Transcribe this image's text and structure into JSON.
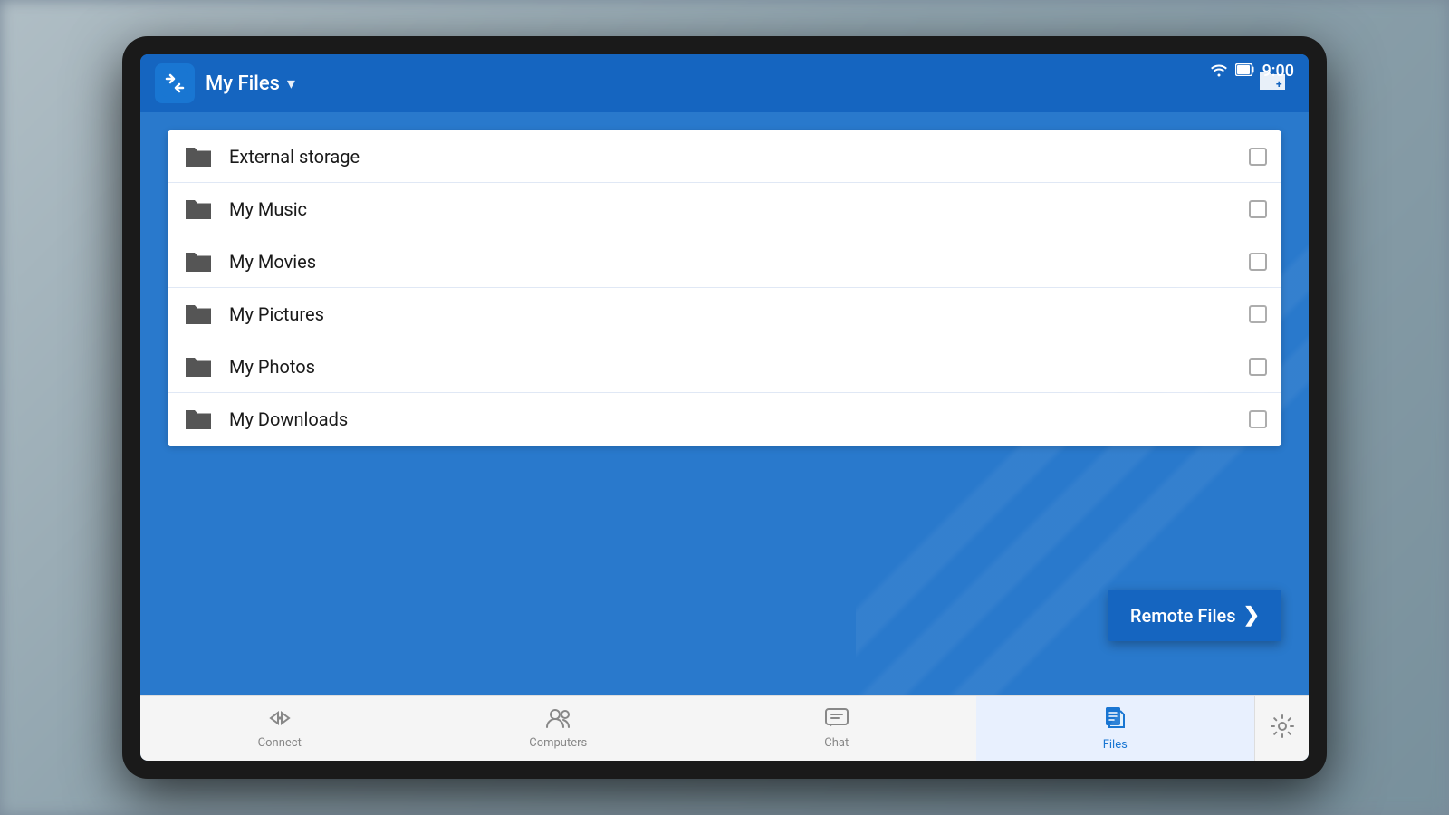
{
  "device": {
    "status_bar": {
      "time": "9:00"
    }
  },
  "header": {
    "title": "My Files",
    "dropdown_label": "My Files",
    "new_folder_tooltip": "New folder"
  },
  "file_list": {
    "items": [
      {
        "id": 1,
        "name": "External storage",
        "checked": false
      },
      {
        "id": 2,
        "name": "My Music",
        "checked": false
      },
      {
        "id": 3,
        "name": "My Movies",
        "checked": false
      },
      {
        "id": 4,
        "name": "My Pictures",
        "checked": false
      },
      {
        "id": 5,
        "name": "My Photos",
        "checked": false
      },
      {
        "id": 6,
        "name": "My Downloads",
        "checked": false
      }
    ]
  },
  "remote_files_button": {
    "label": "Remote Files"
  },
  "bottom_nav": {
    "items": [
      {
        "id": "connect",
        "label": "Connect",
        "icon": "⇄",
        "active": false
      },
      {
        "id": "computers",
        "label": "Computers",
        "icon": "👤+",
        "active": false
      },
      {
        "id": "chat",
        "label": "Chat",
        "icon": "💬",
        "active": false
      },
      {
        "id": "files",
        "label": "Files",
        "icon": "📄",
        "active": true
      }
    ],
    "settings_icon": "⚙"
  }
}
